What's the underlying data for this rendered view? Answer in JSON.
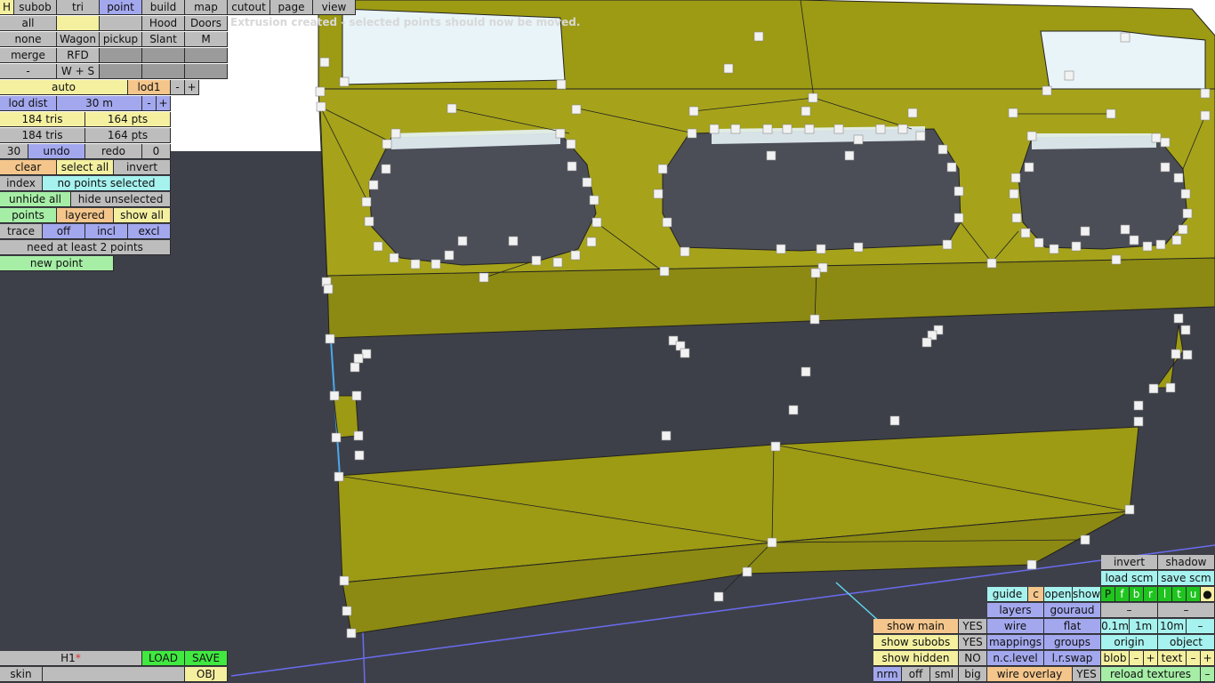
{
  "status_message": "Extrusion created - selected points should now be moved.",
  "top_menu": {
    "h": "H",
    "subob": "subob",
    "tri": "tri",
    "point": "point",
    "build": "build",
    "map": "map",
    "cutout": "cutout",
    "page": "page",
    "view": "view"
  },
  "left_panel": {
    "all": "all",
    "hood": "Hood",
    "doors": "Doors",
    "none": "none",
    "wagon": "Wagon",
    "pickup": "pickup",
    "slant": "Slant",
    "m": "M",
    "merge": "merge",
    "rfd": "RFD",
    "dash": "-",
    "ws": "W + S",
    "auto": "auto",
    "lod1": "lod1",
    "minus": "-",
    "plus": "+",
    "lod_dist_label": "lod dist",
    "lod_dist_value": "30 m",
    "tris1": "184 tris",
    "pts1": "164 pts",
    "tris2": "184 tris",
    "pts2": "164 pts",
    "undo_count": "30",
    "undo": "undo",
    "redo": "redo",
    "redo_count": "0",
    "clear": "clear",
    "select_all": "select all",
    "invert": "invert",
    "index": "index",
    "no_points": "no points selected",
    "unhide_all": "unhide all",
    "hide_unselected": "hide unselected",
    "points": "points",
    "layered": "layered",
    "show_all": "show all",
    "trace": "trace",
    "off": "off",
    "incl": "incl",
    "excl": "excl",
    "need_points": "need at least 2 points",
    "new_point": "new point"
  },
  "bottom_left": {
    "file": "H1",
    "modified_mark": "*",
    "load": "LOAD",
    "save": "SAVE",
    "skin": "skin",
    "obj": "OBJ"
  },
  "bottom_right": {
    "invert": "invert",
    "shadow": "shadow",
    "load_scm": "load scm",
    "save_scm": "save scm",
    "guide": "guide",
    "c": "c",
    "open": "open",
    "show": "show",
    "layer_letters": [
      "P",
      "f",
      "b",
      "r",
      "l",
      "t",
      "u"
    ],
    "dot": "●",
    "layers": "layers",
    "gouraud": "gouraud",
    "dash1": "–",
    "dash2": "–",
    "show_main": "show main",
    "yes1": "YES",
    "wire": "wire",
    "flat": "flat",
    "m01": "0.1m",
    "m1": "1m",
    "m10": "10m",
    "m_minus": "–",
    "show_subobs": "show subobs",
    "yes2": "YES",
    "mappings": "mappings",
    "groups": "groups",
    "origin": "origin",
    "object": "object",
    "show_hidden": "show hidden",
    "no": "NO",
    "nc_level": "n.c.level",
    "lr_swap": "l.r.swap",
    "blob": "blob",
    "blob_minus": "–",
    "blob_plus": "+",
    "text": "text",
    "text_minus": "–",
    "text_plus": "+",
    "nrm": "nrm",
    "off": "off",
    "sml": "sml",
    "big": "big",
    "wire_overlay": "wire overlay",
    "yes3": "YES",
    "reload_textures": "reload textures",
    "reload_minus": "–"
  },
  "colors": {
    "mesh": "#9d9a14",
    "mesh_dark": "#6e6c0c",
    "sky": "#ffffff",
    "ground": "#3e4049"
  }
}
